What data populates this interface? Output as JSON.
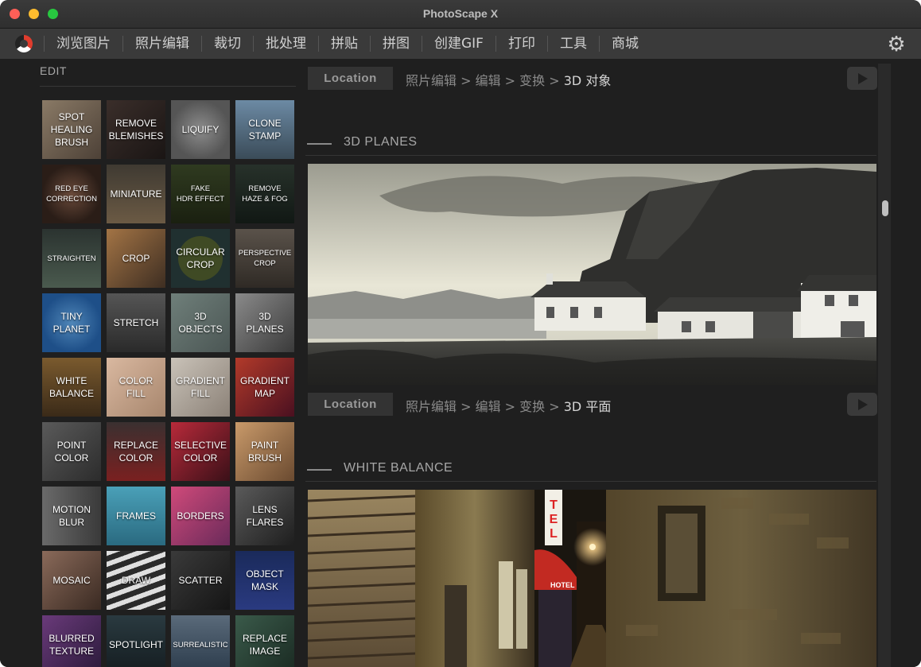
{
  "window": {
    "title": "PhotoScape X"
  },
  "menu": [
    "浏览图片",
    "照片编辑",
    "裁切",
    "批处理",
    "拼贴",
    "拼图",
    "创建GIF",
    "打印",
    "工具",
    "商城"
  ],
  "sidebar": {
    "heading": "EDIT",
    "tiles": [
      {
        "label": "SPOT\nHEALING\nBRUSH",
        "bg": "linear-gradient(135deg,#8a7a66,#4d4137)"
      },
      {
        "label": "REMOVE\nBLEMISHES",
        "bg": "linear-gradient(135deg,#3a2e2a,#1a1514)"
      },
      {
        "label": "LIQUIFY",
        "bg": "radial-gradient(circle at 50% 50%,#8c8c8c,#555 70%)"
      },
      {
        "label": "CLONE\nSTAMP",
        "bg": "linear-gradient(180deg,#6c8aa4,#3a4b58)"
      },
      {
        "label": "RED EYE\nCORRECTION",
        "bg": "radial-gradient(circle,#6a4a3a,#2a1d17 70%)",
        "small": true
      },
      {
        "label": "MINIATURE",
        "bg": "linear-gradient(180deg,#3f3a32,#6b5a44)"
      },
      {
        "label": "FAKE\nHDR EFFECT",
        "bg": "linear-gradient(180deg,#2f3a20,#1a2010)",
        "small": true
      },
      {
        "label": "REMOVE\nHAZE & FOG",
        "bg": "linear-gradient(180deg,#27312a,#111814)",
        "small": true
      },
      {
        "label": "STRAIGHTEN",
        "bg": "linear-gradient(180deg,#2b3330,#4a5a4e)",
        "small": true
      },
      {
        "label": "CROP",
        "bg": "linear-gradient(135deg,#a37445,#3e2e22)"
      },
      {
        "label": "CIRCULAR\nCROP",
        "bg": "#203030",
        "circle": true
      },
      {
        "label": "PERSPECTIVE\nCROP",
        "bg": "linear-gradient(180deg,#5a524a,#2f2a25)",
        "small": true
      },
      {
        "label": "TINY\nPLANET",
        "bg": "radial-gradient(circle,#4f86b8,#1e4f88 70%)"
      },
      {
        "label": "STRETCH",
        "bg": "linear-gradient(180deg,#555,#2a2a2a)"
      },
      {
        "label": "3D\nOBJECTS",
        "bg": "linear-gradient(135deg,#6f7f7a,#4b5654)"
      },
      {
        "label": "3D\nPLANES",
        "bg": "linear-gradient(135deg,#8a8a8a,#3a3a3a)"
      },
      {
        "label": "WHITE\nBALANCE",
        "bg": "linear-gradient(180deg,#7a5a2e,#3a2a18)"
      },
      {
        "label": "COLOR\nFILL",
        "bg": "linear-gradient(135deg,#d9b8a0,#a7866d)"
      },
      {
        "label": "GRADIENT\nFILL",
        "bg": "linear-gradient(135deg,#c9c2b8,#8b8177)"
      },
      {
        "label": "GRADIENT\nMAP",
        "bg": "linear-gradient(135deg,#b23a2a,#4a1020)"
      },
      {
        "label": "POINT\nCOLOR",
        "bg": "linear-gradient(135deg,#5a5a5a,#2c2c2c)"
      },
      {
        "label": "REPLACE\nCOLOR",
        "bg": "linear-gradient(180deg,#3a3030,#7a2020)"
      },
      {
        "label": "SELECTIVE\nCOLOR",
        "bg": "linear-gradient(135deg,#b82a3a,#3a1018)"
      },
      {
        "label": "PAINT\nBRUSH",
        "bg": "linear-gradient(135deg,#c99a6a,#6a4a30)"
      },
      {
        "label": "MOTION\nBLUR",
        "bg": "linear-gradient(90deg,#6a6a6a,#3a3a3a)"
      },
      {
        "label": "FRAMES",
        "bg": "linear-gradient(180deg,#4aa0b8,#2a6a80)"
      },
      {
        "label": "BORDERS",
        "bg": "linear-gradient(135deg,#d04a7a,#6a2a5a)"
      },
      {
        "label": "LENS\nFLARES",
        "bg": "linear-gradient(135deg,#5a5a5a,#1e1e1e)"
      },
      {
        "label": "MOSAIC",
        "bg": "linear-gradient(135deg,#8a6a5a,#3a2a22)"
      },
      {
        "label": "DRAW",
        "bg": "#2a2a2a",
        "stripes": true
      },
      {
        "label": "SCATTER",
        "bg": "linear-gradient(135deg,#3a3a3a,#151515)"
      },
      {
        "label": "OBJECT\nMASK",
        "bg": "linear-gradient(180deg,#1a2a5a,#2a3a80)"
      },
      {
        "label": "BLURRED\nTEXTURE",
        "bg": "linear-gradient(135deg,#6a3a7a,#2a1a3a)"
      },
      {
        "label": "SPOTLIGHT",
        "bg": "linear-gradient(180deg,#2a3a40,#141c20)"
      },
      {
        "label": "SURREALISTIC",
        "bg": "linear-gradient(180deg,#5a6a7a,#2a3a4a)",
        "small": true
      },
      {
        "label": "REPLACE\nIMAGE",
        "bg": "linear-gradient(135deg,#3a5a4a,#1a2a22)"
      }
    ]
  },
  "location_button_label": "Location",
  "sections": {
    "top_path": {
      "prefix": "照片编辑 > 编辑 > 变换 > ",
      "last": "3D 对象"
    },
    "planes": {
      "title": "3D PLANES",
      "path": {
        "prefix": "照片编辑 > 编辑 > 变换 > ",
        "last": "3D 平面"
      }
    },
    "white_balance": {
      "title": "WHITE BALANCE"
    }
  },
  "hotel_sign": {
    "vertical": "TEL",
    "awning": "HOTEL"
  }
}
